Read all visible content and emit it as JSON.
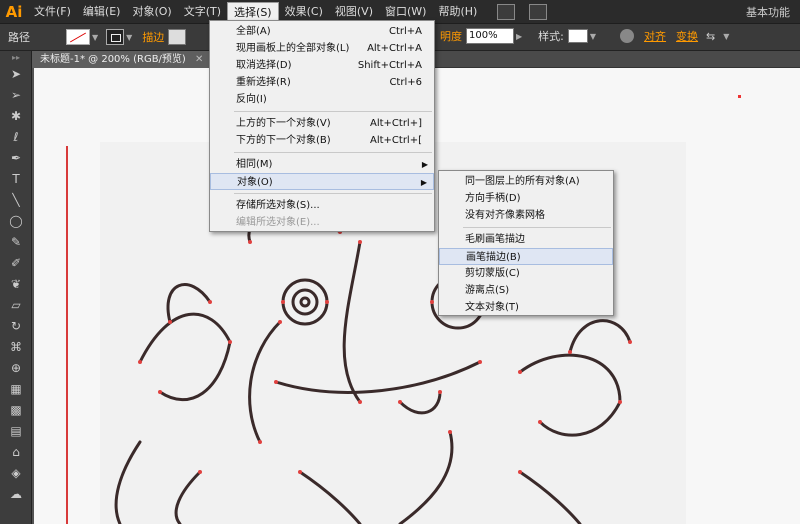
{
  "app": {
    "logo": "Ai",
    "workspace": "基本功能"
  },
  "menubar": {
    "items": [
      "文件(F)",
      "编辑(E)",
      "对象(O)",
      "文字(T)",
      "选择(S)",
      "效果(C)",
      "视图(V)",
      "窗口(W)",
      "帮助(H)"
    ]
  },
  "controlbar": {
    "path_label": "路径",
    "stroke_label": "描边",
    "opacity_label": "不透明度",
    "opacity_visible_label": "明度",
    "opacity_value": "100%",
    "style_label": "样式:",
    "align_label": "对齐",
    "transform_label": "变换"
  },
  "document": {
    "tab_title": "未标题-1* @ 200% (RGB/预览)"
  },
  "select_menu": {
    "items": [
      {
        "label": "全部(A)",
        "shortcut": "Ctrl+A"
      },
      {
        "label": "现用画板上的全部对象(L)",
        "shortcut": "Alt+Ctrl+A"
      },
      {
        "label": "取消选择(D)",
        "shortcut": "Shift+Ctrl+A"
      },
      {
        "label": "重新选择(R)",
        "shortcut": "Ctrl+6"
      },
      {
        "label": "反向(I)",
        "shortcut": ""
      },
      {
        "label": "上方的下一个对象(V)",
        "shortcut": "Alt+Ctrl+]"
      },
      {
        "label": "下方的下一个对象(B)",
        "shortcut": "Alt+Ctrl+["
      },
      {
        "label": "相同(M)",
        "shortcut": ""
      },
      {
        "label": "对象(O)",
        "shortcut": ""
      },
      {
        "label": "存储所选对象(S)...",
        "shortcut": ""
      },
      {
        "label": "编辑所选对象(E)...",
        "shortcut": ""
      }
    ]
  },
  "object_submenu": {
    "items": [
      "同一图层上的所有对象(A)",
      "方向手柄(D)",
      "没有对齐像素网格",
      "毛刷画笔描边",
      "画笔描边(B)",
      "剪切蒙版(C)",
      "游离点(S)",
      "文本对象(T)"
    ]
  },
  "colors": {
    "accent": "#ff9a00",
    "menu_highlight": "#dfe6f3",
    "path_red": "#e0413f"
  }
}
